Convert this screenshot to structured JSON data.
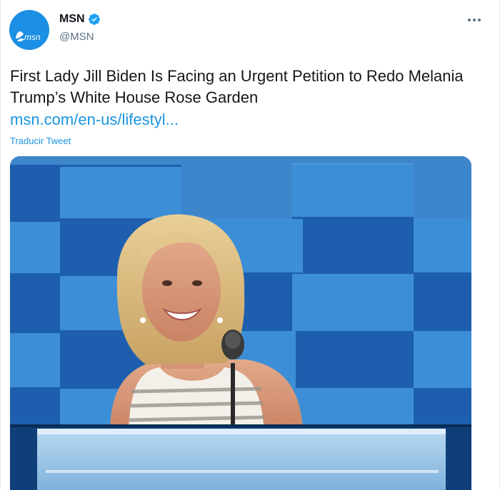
{
  "author": {
    "display_name": "MSN",
    "handle": "@MSN",
    "avatar_text": "msn",
    "avatar_color": "#1a8fe3",
    "verified": true
  },
  "tweet": {
    "text": "First Lady Jill Biden Is Facing an Urgent Petition to Redo Melania Trump’s White House Rose Garden",
    "link": "msn.com/en-us/lifestyl...",
    "translate_label": "Traducir Tweet"
  },
  "icons": {
    "verified": "verified-badge-icon",
    "more": "more-options-icon",
    "avatar_logo": "msn-butterfly-icon"
  },
  "colors": {
    "accent": "#1b95e0",
    "secondary_text": "#5b7083"
  }
}
